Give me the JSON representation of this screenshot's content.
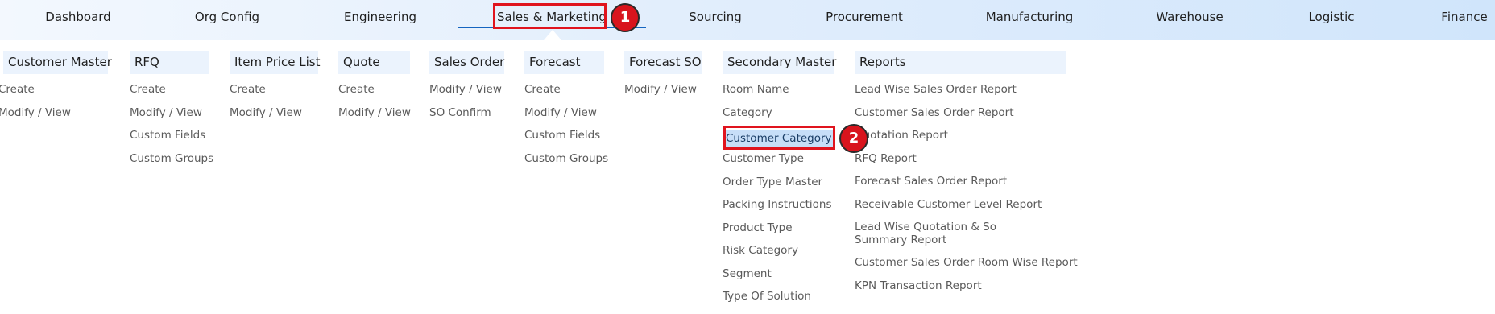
{
  "nav": {
    "items": [
      "Dashboard",
      "Org Config",
      "Engineering",
      "Sales & Marketing",
      "Sourcing",
      "Procurement",
      "Manufacturing",
      "Warehouse",
      "Logistic",
      "Finance"
    ]
  },
  "badges": [
    "1",
    "2"
  ],
  "columns": [
    {
      "title": "Customer Master",
      "items": [
        "Create",
        "Modify / View"
      ]
    },
    {
      "title": "RFQ",
      "items": [
        "Create",
        "Modify / View",
        "Custom Fields",
        "Custom Groups"
      ]
    },
    {
      "title": "Item Price List",
      "items": [
        "Create",
        "Modify / View"
      ]
    },
    {
      "title": "Quote",
      "items": [
        "Create",
        "Modify / View"
      ]
    },
    {
      "title": "Sales Order",
      "items": [
        "Modify / View",
        "SO Confirm"
      ]
    },
    {
      "title": "Forecast",
      "items": [
        "Create",
        "Modify / View",
        "Custom Fields",
        "Custom Groups"
      ]
    },
    {
      "title": "Forecast SO",
      "items": [
        "Modify / View"
      ]
    },
    {
      "title": "Secondary Master",
      "items": [
        "Room Name",
        "Category",
        "Customer Category",
        "Customer Type",
        "Order Type Master",
        "Packing Instructions",
        "Product Type",
        "Risk Category",
        "Segment",
        "Type Of Solution"
      ]
    },
    {
      "title": "Reports",
      "items": [
        "Lead Wise Sales Order Report",
        "Customer Sales Order Report",
        "Quotation Report",
        "RFQ Report",
        "Forecast Sales Order Report",
        "Receivable Customer Level Report",
        "Lead Wise Quotation & So Summary Report",
        "Customer Sales Order Room Wise Report",
        "KPN Transaction Report"
      ]
    }
  ]
}
